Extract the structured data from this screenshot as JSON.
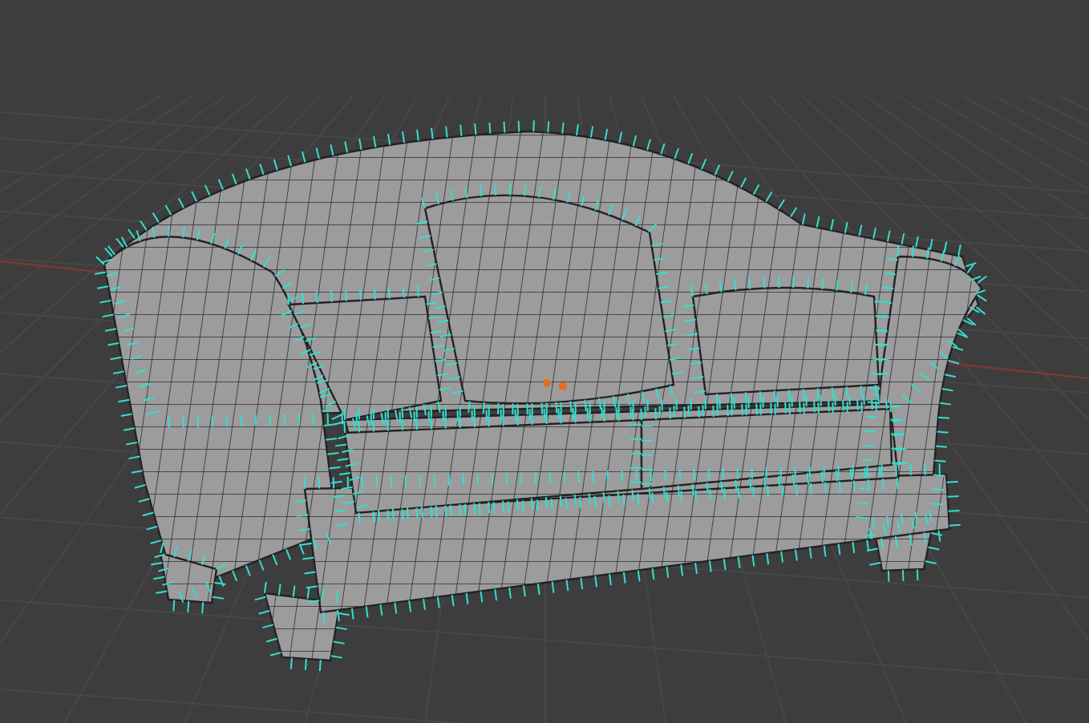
{
  "viewport": {
    "grid_visible": true,
    "x_axis_visible": true,
    "normals_visible": true
  }
}
